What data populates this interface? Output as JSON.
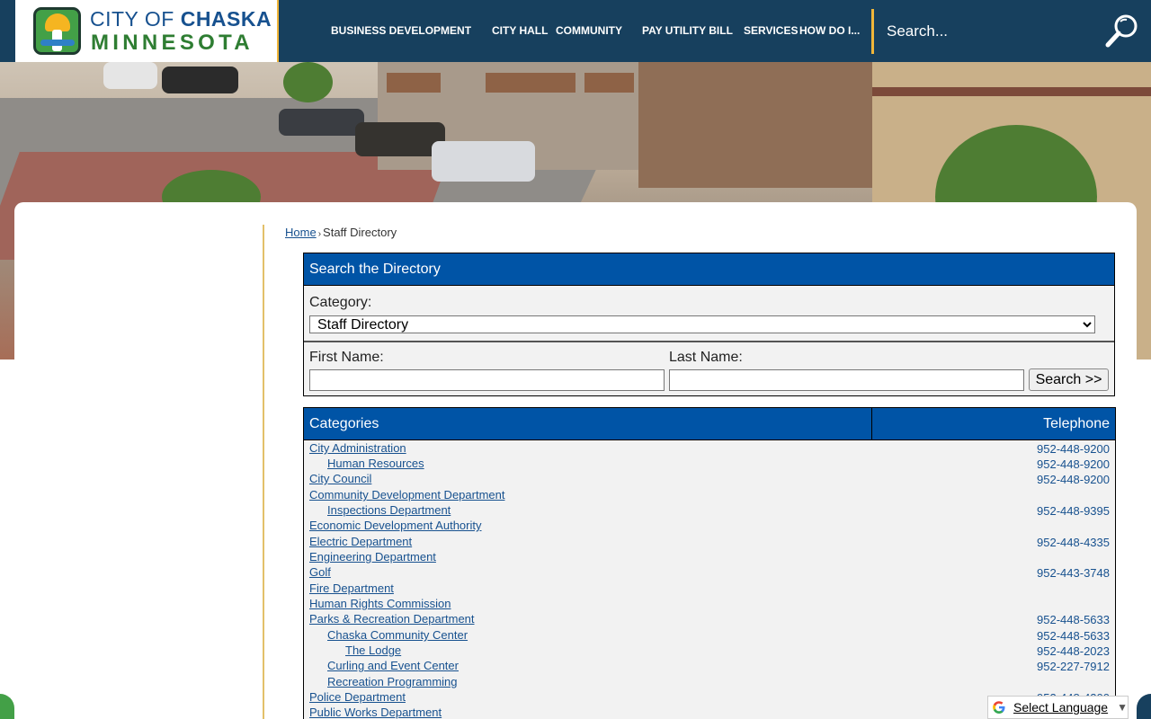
{
  "logo": {
    "line1_prefix": "CITY OF ",
    "line1_bold": "CHASKA",
    "line2": "MINNESOTA"
  },
  "nav": [
    {
      "label": "BUSINESS DEVELOPMENT"
    },
    {
      "label": "CITY HALL"
    },
    {
      "label": "COMMUNITY"
    },
    {
      "label": "PAY UTILITY BILL"
    },
    {
      "label": "SERVICES"
    },
    {
      "label": "HOW DO I..."
    }
  ],
  "search": {
    "placeholder": "Search..."
  },
  "breadcrumb": {
    "home": "Home",
    "current": "Staff Directory"
  },
  "directory": {
    "title": "Search the Directory",
    "category_label": "Category:",
    "category_selected": "Staff Directory",
    "first_name_label": "First Name:",
    "last_name_label": "Last Name:",
    "search_button": "Search >>"
  },
  "categories": {
    "header_name": "Categories",
    "header_tel": "Telephone",
    "rows": [
      {
        "name": "City Administration",
        "level": 0,
        "tel": "952-448-9200"
      },
      {
        "name": "Human Resources",
        "level": 1,
        "tel": "952-448-9200"
      },
      {
        "name": "City Council",
        "level": 0,
        "tel": "952-448-9200"
      },
      {
        "name": "Community Development Department",
        "level": 0,
        "tel": ""
      },
      {
        "name": "Inspections Department",
        "level": 1,
        "tel": "952-448-9395"
      },
      {
        "name": "Economic Development Authority",
        "level": 0,
        "tel": ""
      },
      {
        "name": "Electric Department",
        "level": 0,
        "tel": "952-448-4335"
      },
      {
        "name": "Engineering Department",
        "level": 0,
        "tel": ""
      },
      {
        "name": "Golf",
        "level": 0,
        "tel": "952-443-3748"
      },
      {
        "name": "Fire Department",
        "level": 0,
        "tel": ""
      },
      {
        "name": "Human Rights Commission",
        "level": 0,
        "tel": ""
      },
      {
        "name": "Parks & Recreation Department",
        "level": 0,
        "tel": "952-448-5633"
      },
      {
        "name": "Chaska Community Center",
        "level": 1,
        "tel": "952-448-5633"
      },
      {
        "name": "The Lodge",
        "level": 2,
        "tel": "952-448-2023"
      },
      {
        "name": "Curling and Event Center",
        "level": 1,
        "tel": "952-227-7912"
      },
      {
        "name": "Recreation Programming",
        "level": 1,
        "tel": ""
      },
      {
        "name": "Police Department",
        "level": 0,
        "tel": "952-448-4200"
      },
      {
        "name": "Public Works Department",
        "level": 0,
        "tel": ""
      }
    ]
  },
  "translate": {
    "label": "Select Language"
  },
  "colors": {
    "header": "#17405e",
    "accent": "#f0b63a",
    "table_head": "#0054a6",
    "link": "#17518f"
  }
}
